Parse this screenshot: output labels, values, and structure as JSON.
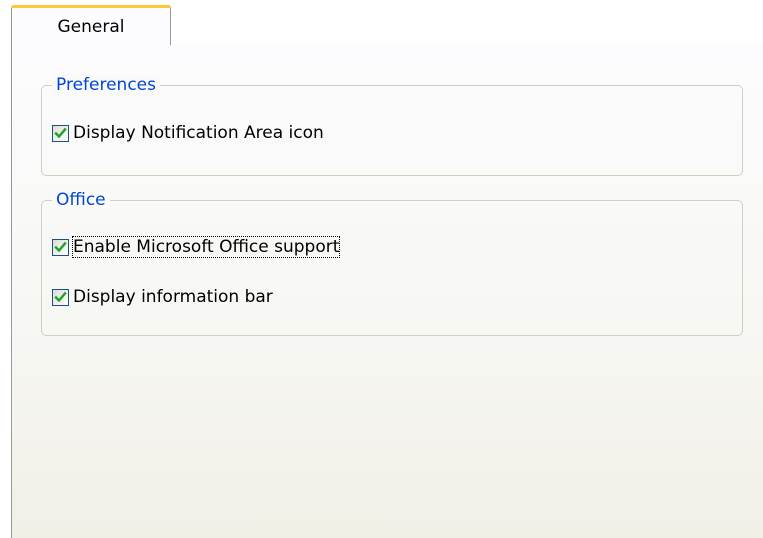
{
  "tabs": [
    {
      "label": "General",
      "selected": true
    }
  ],
  "groups": {
    "preferences": {
      "title": "Preferences",
      "options": [
        {
          "label": "Display Notification Area icon",
          "checked": true
        }
      ]
    },
    "office": {
      "title": "Office",
      "options": [
        {
          "label": "Enable Microsoft Office support",
          "checked": true,
          "focused": true
        },
        {
          "label": "Display information bar",
          "checked": true
        }
      ]
    }
  },
  "colors": {
    "group_title": "#0046d5",
    "checkmark": "#21a121",
    "tab_highlight": "#ffc83c",
    "border": "#919b9c"
  }
}
